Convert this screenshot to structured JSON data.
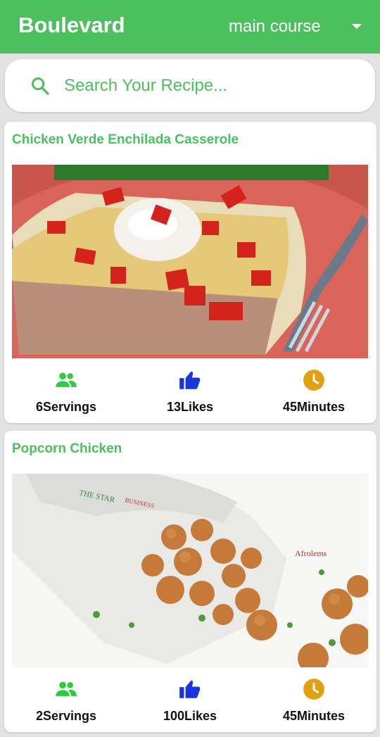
{
  "app": {
    "title": "Boulevard",
    "category": "main course"
  },
  "search": {
    "placeholder": "Search Your Recipe..."
  },
  "colors": {
    "primary": "#4cbf5e",
    "servings_icon": "#2ecc40",
    "likes_icon": "#1a35d8",
    "time_icon": "#e0a010"
  },
  "recipes": [
    {
      "title": "Chicken Verde Enchilada Casserole",
      "servings": "6Servings",
      "likes": "13Likes",
      "time": "45Minutes"
    },
    {
      "title": "Popcorn Chicken",
      "servings": "2Servings",
      "likes": "100Likes",
      "time": "45Minutes",
      "image_watermark": "Afrolems"
    }
  ],
  "icons": [
    "search-icon",
    "dropdown-chevron-icon",
    "people-icon",
    "thumbs-up-icon",
    "clock-icon"
  ]
}
